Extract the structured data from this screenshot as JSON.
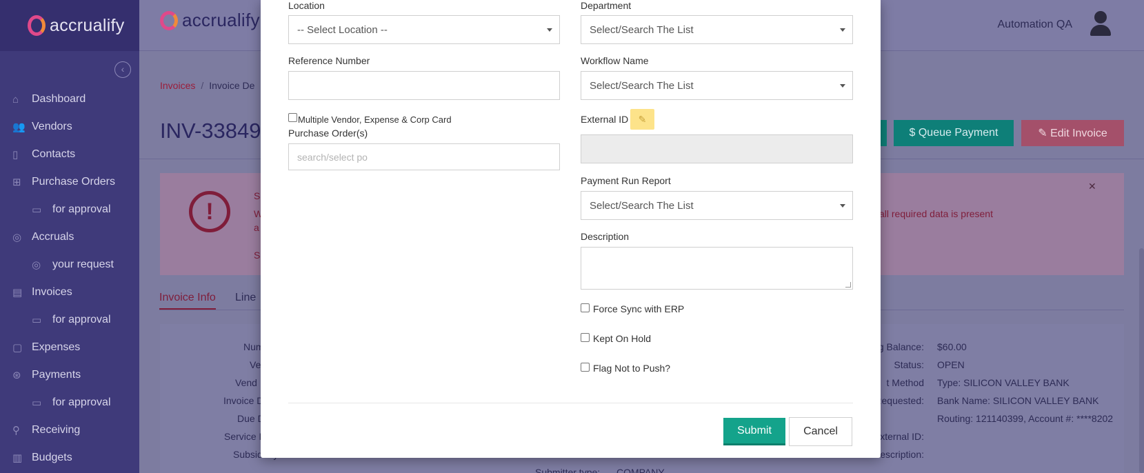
{
  "app": {
    "name": "accrualify"
  },
  "topbar": {
    "user_name": "Automation QA"
  },
  "sidebar": {
    "items": [
      {
        "label": "Dashboard",
        "icon": "home-icon"
      },
      {
        "label": "Vendors",
        "icon": "users-icon"
      },
      {
        "label": "Contacts",
        "icon": "contacts-icon"
      },
      {
        "label": "Purchase Orders",
        "icon": "cart-icon"
      },
      {
        "label": "for approval",
        "icon": "approval-icon"
      },
      {
        "label": "Accruals",
        "icon": "clock-icon"
      },
      {
        "label": "your request",
        "icon": "clock-icon"
      },
      {
        "label": "Invoices",
        "icon": "document-icon"
      },
      {
        "label": "for approval",
        "icon": "approval-icon"
      },
      {
        "label": "Expenses",
        "icon": "receipt-icon"
      },
      {
        "label": "Payments",
        "icon": "coins-icon"
      },
      {
        "label": "for approval",
        "icon": "approval-icon"
      },
      {
        "label": "Receiving",
        "icon": "pin-icon"
      },
      {
        "label": "Budgets",
        "icon": "chart-icon"
      }
    ]
  },
  "page": {
    "breadcrumb": {
      "link": "Invoices",
      "separator": "/",
      "current": "Invoice De"
    },
    "title": "INV-33849",
    "queue_payment_label": "$ Queue Payment",
    "edit_invoice_label": "✎ Edit Invoice",
    "alert_text": "all required data is present",
    "alert_frag_s1": "S",
    "alert_frag_w": "W",
    "alert_frag_a": "a",
    "alert_frag_s2": "S",
    "tab_info": "Invoice Info",
    "tab_line": "Line",
    "left_labels": [
      "Num",
      "Ve",
      "Vend",
      "Invoice D",
      "Due D",
      "Service D",
      "Subsidiary"
    ],
    "right_labels": [
      "g Balance:",
      "Status:",
      "t Method",
      "Requested:",
      "",
      "xternal ID:",
      "escription:"
    ],
    "right_values": [
      "$60.00",
      "OPEN",
      "Type: SILICON VALLEY BANK",
      "Bank Name: SILICON VALLEY BANK",
      "Routing: 121140399, Account #: ****8202",
      "",
      ""
    ],
    "submitter_label": "Submitter type:",
    "submitter_value": "COMPANY"
  },
  "modal": {
    "location": {
      "label": "Location",
      "value": "-- Select Location --"
    },
    "department": {
      "label": "Department",
      "value": "Select/Search The List"
    },
    "reference": {
      "label": "Reference Number",
      "value": ""
    },
    "workflow": {
      "label": "Workflow Name",
      "value": "Select/Search The List"
    },
    "multi_vendor_label": "Multiple Vendor, Expense & Corp Card",
    "external_id": {
      "label": "External ID",
      "value": ""
    },
    "purchase_orders": {
      "label": "Purchase Order(s)",
      "placeholder": "search/select po"
    },
    "payment_run": {
      "label": "Payment Run Report",
      "value": "Select/Search The List"
    },
    "description": {
      "label": "Description"
    },
    "force_sync_label": "Force Sync with ERP",
    "kept_on_hold_label": "Kept On Hold",
    "flag_not_push_label": "Flag Not to Push?",
    "submit_label": "Submit",
    "cancel_label": "Cancel"
  }
}
